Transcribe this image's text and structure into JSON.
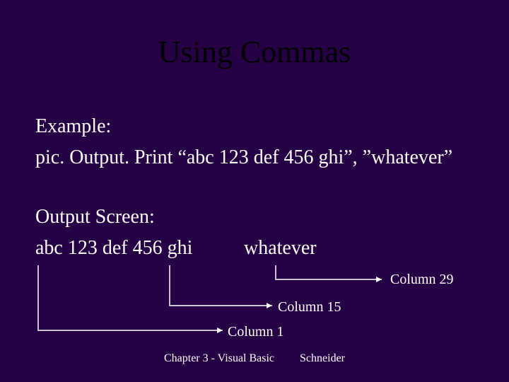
{
  "title": "Using Commas",
  "example_label": "Example:",
  "code_line": "pic. Output. Print “abc 123 def 456 ghi”, ”whatever”",
  "output_label": "Output Screen:",
  "output_value": "abc 123 def 456 ghi",
  "output_value2": "whatever",
  "column_29": "Column 29",
  "column_15": "Column 15",
  "column_1": "Column 1",
  "footer_left": "Chapter 3 - Visual Basic",
  "footer_right": "Schneider"
}
